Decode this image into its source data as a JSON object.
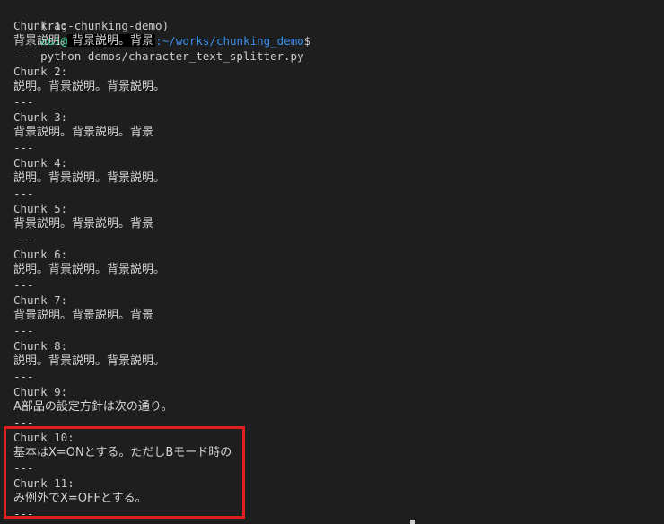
{
  "prompt": {
    "env": "(rag-chunking-demo)",
    "user": "aoi@",
    "path": ":~/works/chunking_demo",
    "symbol": "$",
    "command": "python demos/character_text_splitter.py"
  },
  "separator": "---",
  "chunks": [
    {
      "label": "Chunk 1:",
      "text": "背景説明。背景説明。背景"
    },
    {
      "label": "Chunk 2:",
      "text": "説明。背景説明。背景説明。"
    },
    {
      "label": "Chunk 3:",
      "text": "背景説明。背景説明。背景"
    },
    {
      "label": "Chunk 4:",
      "text": "説明。背景説明。背景説明。"
    },
    {
      "label": "Chunk 5:",
      "text": "背景説明。背景説明。背景"
    },
    {
      "label": "Chunk 6:",
      "text": "説明。背景説明。背景説明。"
    },
    {
      "label": "Chunk 7:",
      "text": "背景説明。背景説明。背景"
    },
    {
      "label": "Chunk 8:",
      "text": "説明。背景説明。背景説明。"
    },
    {
      "label": "Chunk 9:",
      "text": "A部品の設定方針は次の通り。"
    },
    {
      "label": "Chunk 10:",
      "text": "基本はX=ONとする。ただしBモード時の"
    },
    {
      "label": "Chunk 11:",
      "text": "み例外でX=OFFとする。"
    }
  ],
  "colors": {
    "background": "#1e1e1e",
    "text": "#cccccc",
    "user": "#23d18b",
    "path": "#3b8eea",
    "highlight": "#e02020"
  }
}
